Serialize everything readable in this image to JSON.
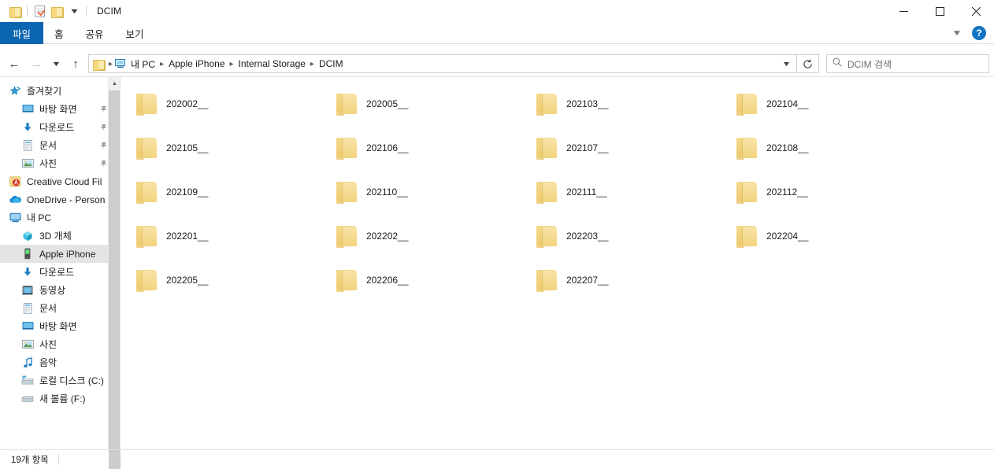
{
  "window": {
    "title": "DCIM",
    "quick_access": [
      {
        "name": "folder-icon",
        "label": "폴더"
      },
      {
        "name": "properties-icon",
        "label": "속성"
      },
      {
        "name": "new-folder-icon",
        "label": "새 폴더"
      },
      {
        "name": "customize-chevron-icon",
        "label": "빠른 실행 도구 모음 사용자 지정"
      }
    ],
    "controls": {
      "minimize": "최소화",
      "maximize": "최대화",
      "close": "닫기"
    }
  },
  "ribbon": {
    "tabs": [
      {
        "label": "파일",
        "active": true
      },
      {
        "label": "홈",
        "active": false
      },
      {
        "label": "공유",
        "active": false
      },
      {
        "label": "보기",
        "active": false
      }
    ],
    "collapse_label": "리본 메뉴 축소",
    "help_label": "?"
  },
  "navigation": {
    "back_label": "뒤로",
    "forward_label": "앞으로",
    "recent_label": "최근 위치",
    "up_label": "위로",
    "refresh_label": "새로 고침",
    "dropdown_label": "이전 위치",
    "breadcrumbs": [
      "내 PC",
      "Apple iPhone",
      "Internal Storage",
      "DCIM"
    ]
  },
  "search": {
    "placeholder": "DCIM 검색",
    "icon": "search-icon"
  },
  "sidebar": {
    "scroll": {
      "up_arrow": "▲"
    },
    "items": [
      {
        "label": "즐겨찾기",
        "icon": "star-icon",
        "level": 0,
        "pinned": false,
        "selected": false
      },
      {
        "label": "바탕 화면",
        "icon": "desktop-icon",
        "level": 1,
        "pinned": true,
        "selected": false
      },
      {
        "label": "다운로드",
        "icon": "download-icon",
        "level": 1,
        "pinned": true,
        "selected": false
      },
      {
        "label": "문서",
        "icon": "documents-icon",
        "level": 1,
        "pinned": true,
        "selected": false
      },
      {
        "label": "사진",
        "icon": "pictures-icon",
        "level": 1,
        "pinned": true,
        "selected": false
      },
      {
        "label": "Creative Cloud Fil",
        "icon": "creative-cloud-icon",
        "level": 0,
        "pinned": false,
        "selected": false
      },
      {
        "label": "OneDrive - Person",
        "icon": "onedrive-icon",
        "level": 0,
        "pinned": false,
        "selected": false
      },
      {
        "label": "내 PC",
        "icon": "this-pc-icon",
        "level": 0,
        "pinned": false,
        "selected": false
      },
      {
        "label": "3D 개체",
        "icon": "3d-objects-icon",
        "level": 1,
        "pinned": false,
        "selected": false
      },
      {
        "label": "Apple iPhone",
        "icon": "phone-icon",
        "level": 1,
        "pinned": false,
        "selected": true
      },
      {
        "label": "다운로드",
        "icon": "download-icon",
        "level": 1,
        "pinned": false,
        "selected": false
      },
      {
        "label": "동영상",
        "icon": "videos-icon",
        "level": 1,
        "pinned": false,
        "selected": false
      },
      {
        "label": "문서",
        "icon": "documents-icon",
        "level": 1,
        "pinned": false,
        "selected": false
      },
      {
        "label": "바탕 화면",
        "icon": "desktop-icon",
        "level": 1,
        "pinned": false,
        "selected": false
      },
      {
        "label": "사진",
        "icon": "pictures-icon",
        "level": 1,
        "pinned": false,
        "selected": false
      },
      {
        "label": "음악",
        "icon": "music-icon",
        "level": 1,
        "pinned": false,
        "selected": false
      },
      {
        "label": "로컬 디스크 (C:)",
        "icon": "local-disk-icon",
        "level": 1,
        "pinned": false,
        "selected": false
      },
      {
        "label": "새 볼륨 (F:)",
        "icon": "drive-icon",
        "level": 1,
        "pinned": false,
        "selected": false
      }
    ]
  },
  "content": {
    "view": "tiles",
    "items": [
      {
        "name": "202002__",
        "icon": "folder-icon"
      },
      {
        "name": "202005__",
        "icon": "folder-icon"
      },
      {
        "name": "202103__",
        "icon": "folder-icon"
      },
      {
        "name": "202104__",
        "icon": "folder-icon"
      },
      {
        "name": "202105__",
        "icon": "folder-icon"
      },
      {
        "name": "202106__",
        "icon": "folder-icon"
      },
      {
        "name": "202107__",
        "icon": "folder-icon"
      },
      {
        "name": "202108__",
        "icon": "folder-icon"
      },
      {
        "name": "202109__",
        "icon": "folder-icon"
      },
      {
        "name": "202110__",
        "icon": "folder-icon"
      },
      {
        "name": "202111__",
        "icon": "folder-icon"
      },
      {
        "name": "202112__",
        "icon": "folder-icon"
      },
      {
        "name": "202201__",
        "icon": "folder-icon"
      },
      {
        "name": "202202__",
        "icon": "folder-icon"
      },
      {
        "name": "202203__",
        "icon": "folder-icon"
      },
      {
        "name": "202204__",
        "icon": "folder-icon"
      },
      {
        "name": "202205__",
        "icon": "folder-icon"
      },
      {
        "name": "202206__",
        "icon": "folder-icon"
      },
      {
        "name": "202207__",
        "icon": "folder-icon"
      }
    ]
  },
  "statusbar": {
    "item_count": "19개 항목"
  },
  "colors": {
    "accent": "#0b66b1",
    "folder": "#f2d47e",
    "selection": "#e4e4e4",
    "help_blue": "#1175c4"
  }
}
